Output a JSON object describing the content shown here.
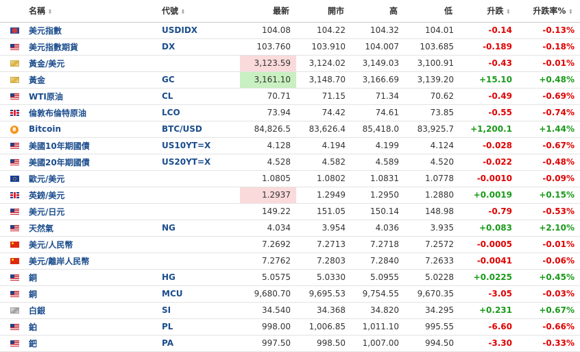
{
  "headers": {
    "name": "名稱",
    "symbol": "代號",
    "last": "最新",
    "open": "開市",
    "high": "高",
    "low": "低",
    "change": "升跌",
    "change_pct": "升跌率%",
    "sort_glyph": "⬍"
  },
  "rows": [
    {
      "flag": "index-icon",
      "name": "美元指數",
      "symbol": "USDIDX",
      "last": "104.08",
      "open": "104.22",
      "high": "104.32",
      "low": "104.01",
      "change": "-0.14",
      "change_pct": "-0.13%",
      "dir": "down",
      "hl": ""
    },
    {
      "flag": "us-flag-icon",
      "name": "美元指數期貨",
      "symbol": "DX",
      "last": "103.760",
      "open": "103.910",
      "high": "104.007",
      "low": "103.685",
      "change": "-0.189",
      "change_pct": "-0.18%",
      "dir": "down",
      "hl": ""
    },
    {
      "flag": "gold-icon",
      "name": "黃金/美元",
      "symbol": "",
      "last": "3,123.59",
      "open": "3,124.02",
      "high": "3,149.03",
      "low": "3,100.91",
      "change": "-0.43",
      "change_pct": "-0.01%",
      "dir": "down",
      "hl": "red"
    },
    {
      "flag": "gold-icon",
      "name": "黃金",
      "symbol": "GC",
      "last": "3,161.10",
      "open": "3,148.70",
      "high": "3,166.69",
      "low": "3,139.20",
      "change": "+15.10",
      "change_pct": "+0.48%",
      "dir": "up",
      "hl": "green"
    },
    {
      "flag": "us-flag-icon",
      "name": "WTI原油",
      "symbol": "CL",
      "last": "70.71",
      "open": "71.15",
      "high": "71.34",
      "low": "70.62",
      "change": "-0.49",
      "change_pct": "-0.69%",
      "dir": "down",
      "hl": ""
    },
    {
      "flag": "uk-flag-icon",
      "name": "倫敦布倫特原油",
      "symbol": "LCO",
      "last": "73.94",
      "open": "74.42",
      "high": "74.61",
      "low": "73.85",
      "change": "-0.55",
      "change_pct": "-0.74%",
      "dir": "down",
      "hl": ""
    },
    {
      "flag": "bitcoin-icon",
      "name": "Bitcoin",
      "symbol": "BTC/USD",
      "last": "84,826.5",
      "open": "83,626.4",
      "high": "85,418.0",
      "low": "83,925.7",
      "change": "+1,200.1",
      "change_pct": "+1.44%",
      "dir": "up",
      "hl": ""
    },
    {
      "flag": "us-flag-icon",
      "name": "美國10年期國債",
      "symbol": "US10YT=X",
      "last": "4.128",
      "open": "4.194",
      "high": "4.199",
      "low": "4.124",
      "change": "-0.028",
      "change_pct": "-0.67%",
      "dir": "down",
      "hl": ""
    },
    {
      "flag": "us-flag-icon",
      "name": "美國20年期國債",
      "symbol": "US20YT=X",
      "last": "4.528",
      "open": "4.582",
      "high": "4.589",
      "low": "4.520",
      "change": "-0.022",
      "change_pct": "-0.48%",
      "dir": "down",
      "hl": ""
    },
    {
      "flag": "eu-flag-icon",
      "name": "歐元/美元",
      "symbol": "",
      "last": "1.0805",
      "open": "1.0802",
      "high": "1.0831",
      "low": "1.0778",
      "change": "-0.0010",
      "change_pct": "-0.09%",
      "dir": "down",
      "hl": ""
    },
    {
      "flag": "uk-flag-icon",
      "name": "英鎊/美元",
      "symbol": "",
      "last": "1.2937",
      "open": "1.2949",
      "high": "1.2950",
      "low": "1.2880",
      "change": "+0.0019",
      "change_pct": "+0.15%",
      "dir": "up",
      "hl": "red"
    },
    {
      "flag": "us-flag-icon",
      "name": "美元/日元",
      "symbol": "",
      "last": "149.22",
      "open": "151.05",
      "high": "150.14",
      "low": "148.98",
      "change": "-0.79",
      "change_pct": "-0.53%",
      "dir": "down",
      "hl": ""
    },
    {
      "flag": "us-flag-icon",
      "name": "天然氣",
      "symbol": "NG",
      "last": "4.034",
      "open": "3.954",
      "high": "4.036",
      "low": "3.935",
      "change": "+0.083",
      "change_pct": "+2.10%",
      "dir": "up",
      "hl": ""
    },
    {
      "flag": "cn-flag-icon",
      "name": "美元/人民幣",
      "symbol": "",
      "last": "7.2692",
      "open": "7.2713",
      "high": "7.2718",
      "low": "7.2572",
      "change": "-0.0005",
      "change_pct": "-0.01%",
      "dir": "down",
      "hl": ""
    },
    {
      "flag": "cn-flag-icon",
      "name": "美元/離岸人民幣",
      "symbol": "",
      "last": "7.2762",
      "open": "7.2803",
      "high": "7.2840",
      "low": "7.2633",
      "change": "-0.0041",
      "change_pct": "-0.06%",
      "dir": "down",
      "hl": ""
    },
    {
      "flag": "us-flag-icon",
      "name": "銅",
      "symbol": "HG",
      "last": "5.0575",
      "open": "5.0330",
      "high": "5.0955",
      "low": "5.0228",
      "change": "+0.0225",
      "change_pct": "+0.45%",
      "dir": "up",
      "hl": ""
    },
    {
      "flag": "us-flag-icon",
      "name": "銅",
      "symbol": "MCU",
      "last": "9,680.70",
      "open": "9,695.53",
      "high": "9,754.55",
      "low": "9,670.35",
      "change": "-3.05",
      "change_pct": "-0.03%",
      "dir": "down",
      "hl": ""
    },
    {
      "flag": "silver-icon",
      "name": "白銀",
      "symbol": "SI",
      "last": "34.540",
      "open": "34.368",
      "high": "34.820",
      "low": "34.295",
      "change": "+0.231",
      "change_pct": "+0.67%",
      "dir": "up",
      "hl": ""
    },
    {
      "flag": "us-flag-icon",
      "name": "鉑",
      "symbol": "PL",
      "last": "998.00",
      "open": "1,006.85",
      "high": "1,011.10",
      "low": "995.55",
      "change": "-6.60",
      "change_pct": "-0.66%",
      "dir": "down",
      "hl": ""
    },
    {
      "flag": "us-flag-icon",
      "name": "鈀",
      "symbol": "PA",
      "last": "997.50",
      "open": "998.50",
      "high": "1,007.00",
      "low": "994.50",
      "change": "-3.30",
      "change_pct": "-0.33%",
      "dir": "down",
      "hl": ""
    }
  ]
}
